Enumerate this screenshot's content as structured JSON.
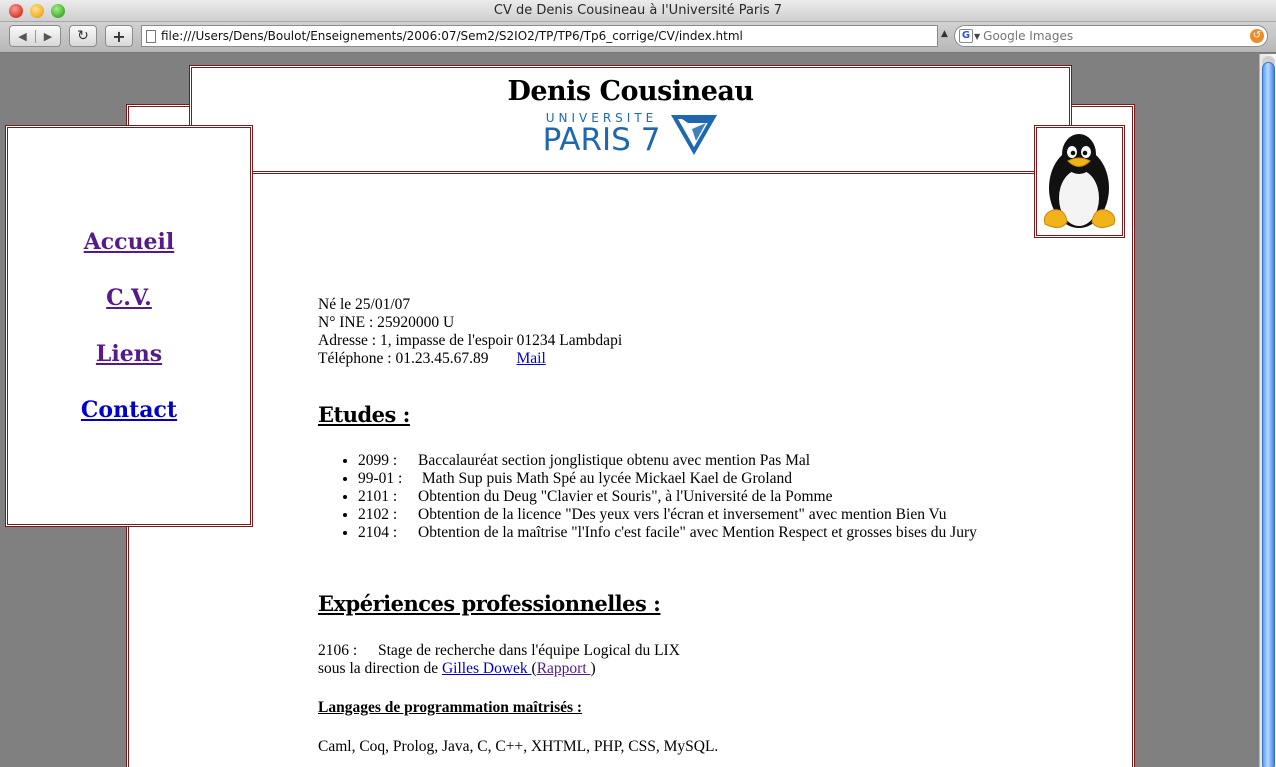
{
  "window": {
    "title": "CV de Denis Cousineau à l'Université Paris 7"
  },
  "toolbar": {
    "back_icon": "◀",
    "forward_icon": "▶",
    "reload_icon": "↻",
    "add_icon": "+",
    "url": "file:///Users/Dens/Boulot/Enseignements/2006:07/Sem2/S2IO2/TP/TP6/Tp6_corrige/CV/index.html",
    "search_engine_icon": "G",
    "search_placeholder": "Google Images"
  },
  "header": {
    "title": "Denis Cousineau",
    "logo_small": "UNIVERSITE",
    "logo_big": "PARIS 7"
  },
  "nav": {
    "items": [
      {
        "label": "Accueil "
      },
      {
        "label": "C.V. "
      },
      {
        "label": "Liens "
      },
      {
        "label": "Contact"
      }
    ]
  },
  "info": {
    "born": "Né le 25/01/07",
    "ine": "N° INE : 25920000 U",
    "address": "Adresse : 1, impasse de l'espoir 01234 Lambdapi",
    "phone": "Téléphone : 01.23.45.67.89",
    "mail_link": "Mail "
  },
  "studies": {
    "title": "Etudes :",
    "items": [
      {
        "year": "2099 :",
        "text": "Baccalauréat section jonglistique obtenu avec mention Pas Mal"
      },
      {
        "year": "99-01 :",
        "text": " Math Sup puis Math Spé au lycée Mickael Kael de Groland"
      },
      {
        "year": "2101 :",
        "text": "Obtention du Deug \"Clavier et Souris\", à l'Université de la Pomme"
      },
      {
        "year": "2102 :",
        "text": "Obtention de la licence \"Des yeux vers l'écran et inversement\" avec mention Bien Vu"
      },
      {
        "year": "2104 :",
        "text": "Obtention de la maîtrise \"l'Info c'est facile\" avec Mention Respect et grosses bises du Jury"
      }
    ]
  },
  "experience": {
    "title": "Expériences professionnelles :",
    "year": "2106 :",
    "line1": "Stage de recherche dans l'équipe Logical du LIX",
    "line2_prefix": "sous la direction de ",
    "advisor_link": "Gilles Dowek ",
    "open_paren": " (",
    "report_link": "Rapport ",
    "close_paren": ")"
  },
  "languages": {
    "title": "Langages de programmation maîtrisés :",
    "list": "Caml, Coq, Prolog, Java, C, C++, XHTML, PHP, CSS, MySQL."
  },
  "colors": {
    "border": "#7a1a1a",
    "link": "#0000cc",
    "visited_link": "#551a8b",
    "logo_blue": "#1f68b0",
    "page_bg": "#808080"
  }
}
